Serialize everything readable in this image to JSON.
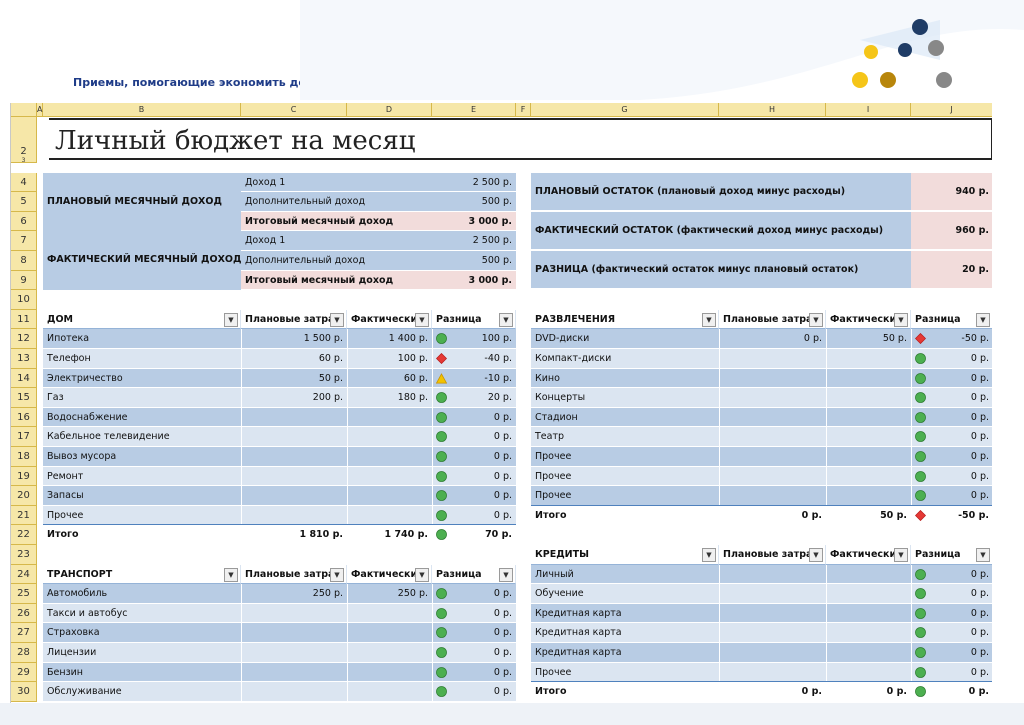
{
  "header": {
    "subtitle": "Приемы, помогающие экономить деньги"
  },
  "sheet": {
    "title": "Личный бюджет на месяц",
    "columns": [
      "A",
      "B",
      "C",
      "D",
      "E",
      "F",
      "G",
      "H",
      "I",
      "J"
    ],
    "rows": [
      "3",
      "4",
      "5",
      "6",
      "7",
      "8",
      "9",
      "10",
      "11",
      "12",
      "13",
      "14",
      "15",
      "16",
      "17",
      "18",
      "19",
      "20",
      "21",
      "22",
      "23",
      "24",
      "25",
      "26",
      "27",
      "28",
      "29",
      "30"
    ],
    "row2": "2"
  },
  "income": {
    "planned_label": "ПЛАНОВЫЙ МЕСЯЧНЫЙ ДОХОД",
    "actual_label": "ФАКТИЧЕСКИЙ МЕСЯЧНЫЙ ДОХОД",
    "planned_rows": [
      {
        "label": "Доход 1",
        "value": "2 500 р."
      },
      {
        "label": "Дополнительный доход",
        "value": "500 р."
      },
      {
        "label": "Итоговый месячный доход",
        "value": "3 000 р."
      }
    ],
    "actual_rows": [
      {
        "label": "Доход 1",
        "value": "2 500 р."
      },
      {
        "label": "Дополнительный доход",
        "value": "500 р."
      },
      {
        "label": "Итоговый месячный доход",
        "value": "3 000 р."
      }
    ]
  },
  "balance": [
    {
      "label": "ПЛАНОВЫЙ ОСТАТОК (плановый доход минус расходы)",
      "value": "940 р."
    },
    {
      "label": "ФАКТИЧЕСКИЙ ОСТАТОК (фактический доход минус расходы)",
      "value": "960 р."
    },
    {
      "label": "РАЗНИЦА (фактический остаток минус плановый остаток)",
      "value": "20 р."
    }
  ],
  "headers": {
    "planned": "Плановые затра",
    "actual": "Фактически",
    "diff": "Разница"
  },
  "home": {
    "title": "ДОМ",
    "rows": [
      {
        "name": "Ипотека",
        "plan": "1 500 р.",
        "fact": "1 400 р.",
        "diff": "100 р.",
        "status": "good"
      },
      {
        "name": "Телефон",
        "plan": "60 р.",
        "fact": "100 р.",
        "diff": "-40 р.",
        "status": "bad"
      },
      {
        "name": "Электричество",
        "plan": "50 р.",
        "fact": "60 р.",
        "diff": "-10 р.",
        "status": "warn"
      },
      {
        "name": "Газ",
        "plan": "200 р.",
        "fact": "180 р.",
        "diff": "20 р.",
        "status": "good"
      },
      {
        "name": "Водоснабжение",
        "plan": "",
        "fact": "",
        "diff": "0 р.",
        "status": "good"
      },
      {
        "name": "Кабельное телевидение",
        "plan": "",
        "fact": "",
        "diff": "0 р.",
        "status": "good"
      },
      {
        "name": "Вывоз мусора",
        "plan": "",
        "fact": "",
        "diff": "0 р.",
        "status": "good"
      },
      {
        "name": "Ремонт",
        "plan": "",
        "fact": "",
        "diff": "0 р.",
        "status": "good"
      },
      {
        "name": "Запасы",
        "plan": "",
        "fact": "",
        "diff": "0 р.",
        "status": "good"
      },
      {
        "name": "Прочее",
        "plan": "",
        "fact": "",
        "diff": "0 р.",
        "status": "good"
      }
    ],
    "total": {
      "name": "Итого",
      "plan": "1 810 р.",
      "fact": "1 740 р.",
      "diff": "70 р.",
      "status": "good"
    }
  },
  "fun": {
    "title": "РАЗВЛЕЧЕНИЯ",
    "rows": [
      {
        "name": "DVD-диски",
        "plan": "0 р.",
        "fact": "50 р.",
        "diff": "-50 р.",
        "status": "bad"
      },
      {
        "name": "Компакт-диски",
        "plan": "",
        "fact": "",
        "diff": "0 р.",
        "status": "good"
      },
      {
        "name": "Кино",
        "plan": "",
        "fact": "",
        "diff": "0 р.",
        "status": "good"
      },
      {
        "name": "Концерты",
        "plan": "",
        "fact": "",
        "diff": "0 р.",
        "status": "good"
      },
      {
        "name": "Стадион",
        "plan": "",
        "fact": "",
        "diff": "0 р.",
        "status": "good"
      },
      {
        "name": "Театр",
        "plan": "",
        "fact": "",
        "diff": "0 р.",
        "status": "good"
      },
      {
        "name": "Прочее",
        "plan": "",
        "fact": "",
        "diff": "0 р.",
        "status": "good"
      },
      {
        "name": "Прочее",
        "plan": "",
        "fact": "",
        "diff": "0 р.",
        "status": "good"
      },
      {
        "name": "Прочее",
        "plan": "",
        "fact": "",
        "diff": "0 р.",
        "status": "good"
      }
    ],
    "total": {
      "name": "Итого",
      "plan": "0 р.",
      "fact": "50 р.",
      "diff": "-50 р.",
      "status": "bad"
    }
  },
  "transport": {
    "title": "ТРАНСПОРТ",
    "rows": [
      {
        "name": "Автомобиль",
        "plan": "250 р.",
        "fact": "250 р.",
        "diff": "0 р.",
        "status": "good"
      },
      {
        "name": "Такси и автобус",
        "plan": "",
        "fact": "",
        "diff": "0 р.",
        "status": "good"
      },
      {
        "name": "Страховка",
        "plan": "",
        "fact": "",
        "diff": "0 р.",
        "status": "good"
      },
      {
        "name": "Лицензии",
        "plan": "",
        "fact": "",
        "diff": "0 р.",
        "status": "good"
      },
      {
        "name": "Бензин",
        "plan": "",
        "fact": "",
        "diff": "0 р.",
        "status": "good"
      },
      {
        "name": "Обслуживание",
        "plan": "",
        "fact": "",
        "diff": "0 р.",
        "status": "good"
      }
    ]
  },
  "credits": {
    "title": "КРЕДИТЫ",
    "rows": [
      {
        "name": "Личный",
        "plan": "",
        "fact": "",
        "diff": "0 р.",
        "status": "good"
      },
      {
        "name": "Обучение",
        "plan": "",
        "fact": "",
        "diff": "0 р.",
        "status": "good"
      },
      {
        "name": "Кредитная карта",
        "plan": "",
        "fact": "",
        "diff": "0 р.",
        "status": "good"
      },
      {
        "name": "Кредитная карта",
        "plan": "",
        "fact": "",
        "diff": "0 р.",
        "status": "good"
      },
      {
        "name": "Кредитная карта",
        "plan": "",
        "fact": "",
        "diff": "0 р.",
        "status": "good"
      },
      {
        "name": "Прочее",
        "plan": "",
        "fact": "",
        "diff": "0 р.",
        "status": "good"
      }
    ],
    "total": {
      "name": "Итого",
      "plan": "0 р.",
      "fact": "0 р.",
      "diff": "0 р.",
      "status": "good"
    }
  },
  "colors": {
    "blue": "#b8cce4",
    "light_blue": "#dbe5f1",
    "pink": "#f2dcdb",
    "good": "#4caf50",
    "bad": "#e53935",
    "warn": "#f2c200",
    "header_bg": "#f6e7a8"
  }
}
